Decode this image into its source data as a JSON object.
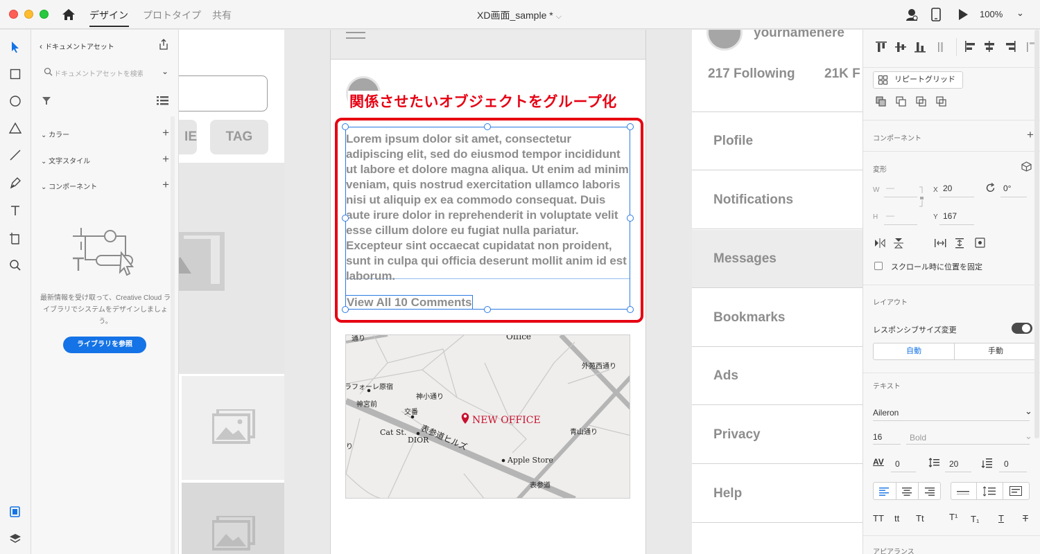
{
  "window": {
    "tabs": [
      "デザイン",
      "プロトタイプ",
      "共有"
    ],
    "title": "XD画面_sample *",
    "zoom": "100%"
  },
  "assets": {
    "header": "ドキュメントアセット",
    "search_placeholder": "ドキュメントアセットを検索",
    "sections": [
      "カラー",
      "文字スタイル",
      "コンポーネント"
    ],
    "empty_message": "最新情報を受け取って、Creative Cloud ライブラリでシステムをデザインしましょう。",
    "library_button": "ライブラリを参照"
  },
  "canvas": {
    "left_artboard": {
      "tag_button": "TAG",
      "partial_button": "IE"
    },
    "annotation": "関係させたいオブジェクトをグループ化",
    "post_text": "Lorem ipsum dolor sit amet, consectetur adipiscing elit, sed do eiusmod tempor incididunt ut labore et dolore magna aliqua. Ut enim ad minim veniam, quis nostrud exercitation ullamco laboris nisi ut aliquip ex ea commodo consequat. Duis aute irure dolor in reprehenderit in voluptate velit esse cillum dolore eu fugiat nulla pariatur. Excepteur sint occaecat cupidatat non proident, sunt in culpa qui officia deserunt mollit anim id est laborum.",
    "comments_link": "View All 10 Comments",
    "map": {
      "marker_label": "NEW OFFICE",
      "labels": [
        "Office",
        "外苑西通り",
        "ラフォーレ原宿",
        "神小通り",
        "神宮前",
        "交番",
        "表参道ヒルズ",
        "Cat St.",
        "DIOR",
        "青山通り",
        "Apple Store",
        "表参道",
        "通り",
        "り"
      ]
    },
    "right_artboard": {
      "username": "yournamehere",
      "following": "217 Following",
      "followers": "21K F",
      "menu": [
        "Plofile",
        "Notifications",
        "Messages",
        "Bookmarks",
        "Ads",
        "Privacy",
        "Help"
      ]
    }
  },
  "properties": {
    "repeat_grid": "リピートグリッド",
    "component_section": "コンポーネント",
    "transform_section": "変形",
    "w_label": "W",
    "h_label": "H",
    "w_value": "—",
    "h_value": "—",
    "x_label": "X",
    "x_value": "20",
    "y_label": "Y",
    "y_value": "167",
    "rotation": "0°",
    "fix_scroll": "スクロール時に位置を固定",
    "layout_section": "レイアウト",
    "responsive": "レスポンシブサイズ変更",
    "auto": "自動",
    "manual": "手動",
    "text_section": "テキスト",
    "font": "Aileron",
    "font_size": "16",
    "font_weight": "Bold",
    "char_spacing": "0",
    "line_spacing": "20",
    "para_spacing": "0",
    "case_buttons": [
      "TT",
      "tt",
      "Tt",
      "T¹",
      "T₁",
      "T",
      "T"
    ],
    "appearance_section": "アピアランス"
  },
  "colors": {
    "accent": "#1473e6",
    "annotation_red": "#e60012",
    "selection_blue": "#2a7ae2",
    "map_marker": "#c8102e"
  }
}
